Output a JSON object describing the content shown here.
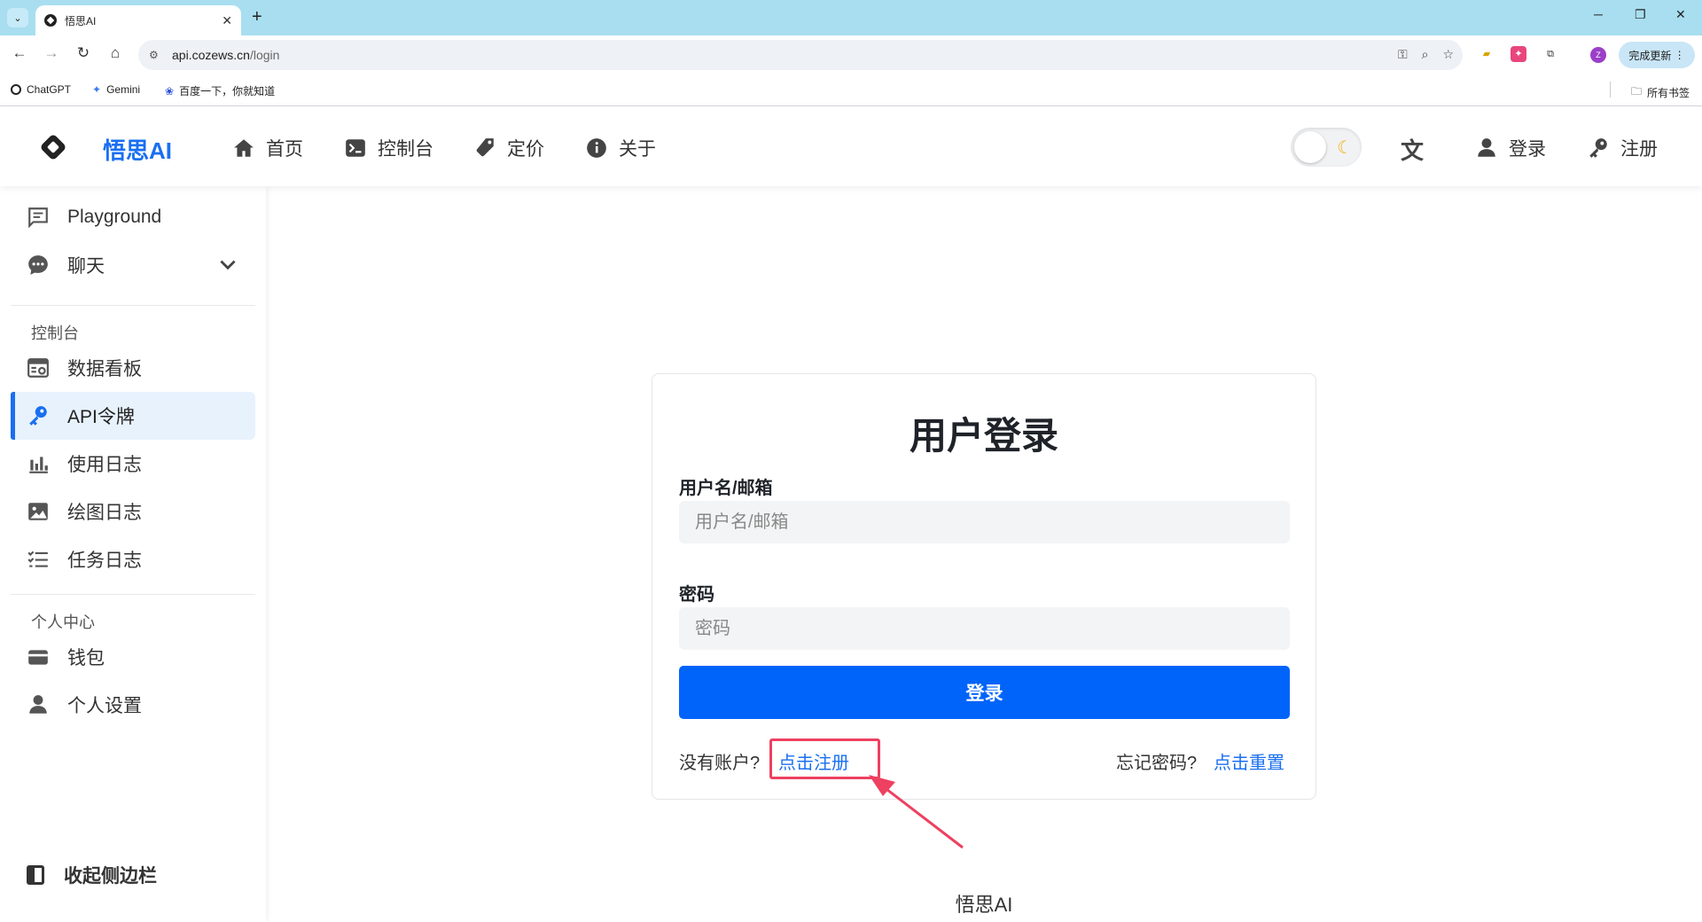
{
  "browser": {
    "tab_title": "悟思AI",
    "url_domain": "api.cozews.cn",
    "url_path": "/login",
    "update_button": "完成更新",
    "profile_initial": "Z",
    "bookmarks": [
      {
        "label": "ChatGPT"
      },
      {
        "label": "Gemini"
      },
      {
        "label": "百度一下，你就知道"
      }
    ],
    "all_bookmarks": "所有书签"
  },
  "header": {
    "brand": "悟思AI",
    "nav": [
      {
        "label": "首页",
        "icon": "home-icon"
      },
      {
        "label": "控制台",
        "icon": "terminal-icon"
      },
      {
        "label": "定价",
        "icon": "price-tag-icon"
      },
      {
        "label": "关于",
        "icon": "info-icon"
      }
    ],
    "login": "登录",
    "register": "注册"
  },
  "sidebar": {
    "playground": "Playground",
    "chat": "聊天",
    "console_section": "控制台",
    "console_items": [
      {
        "label": "数据看板",
        "icon": "dashboard-icon"
      },
      {
        "label": "API令牌",
        "icon": "key-icon",
        "active": true
      },
      {
        "label": "使用日志",
        "icon": "bar-chart-icon"
      },
      {
        "label": "绘图日志",
        "icon": "image-icon"
      },
      {
        "label": "任务日志",
        "icon": "task-list-icon"
      }
    ],
    "personal_section": "个人中心",
    "personal_items": [
      {
        "label": "钱包",
        "icon": "wallet-icon"
      },
      {
        "label": "个人设置",
        "icon": "user-icon"
      }
    ],
    "collapse": "收起侧边栏"
  },
  "login_card": {
    "title": "用户登录",
    "username_label": "用户名/邮箱",
    "username_placeholder": "用户名/邮箱",
    "password_label": "密码",
    "password_placeholder": "密码",
    "submit": "登录",
    "no_account": "没有账户?",
    "register_link": "点击注册",
    "forgot": "忘记密码?",
    "reset_link": "点击重置"
  },
  "footer": {
    "brand": "悟思AI"
  },
  "colors": {
    "accent": "#1a6ff0",
    "button": "#0064fa",
    "highlight_box": "#ee4060"
  }
}
